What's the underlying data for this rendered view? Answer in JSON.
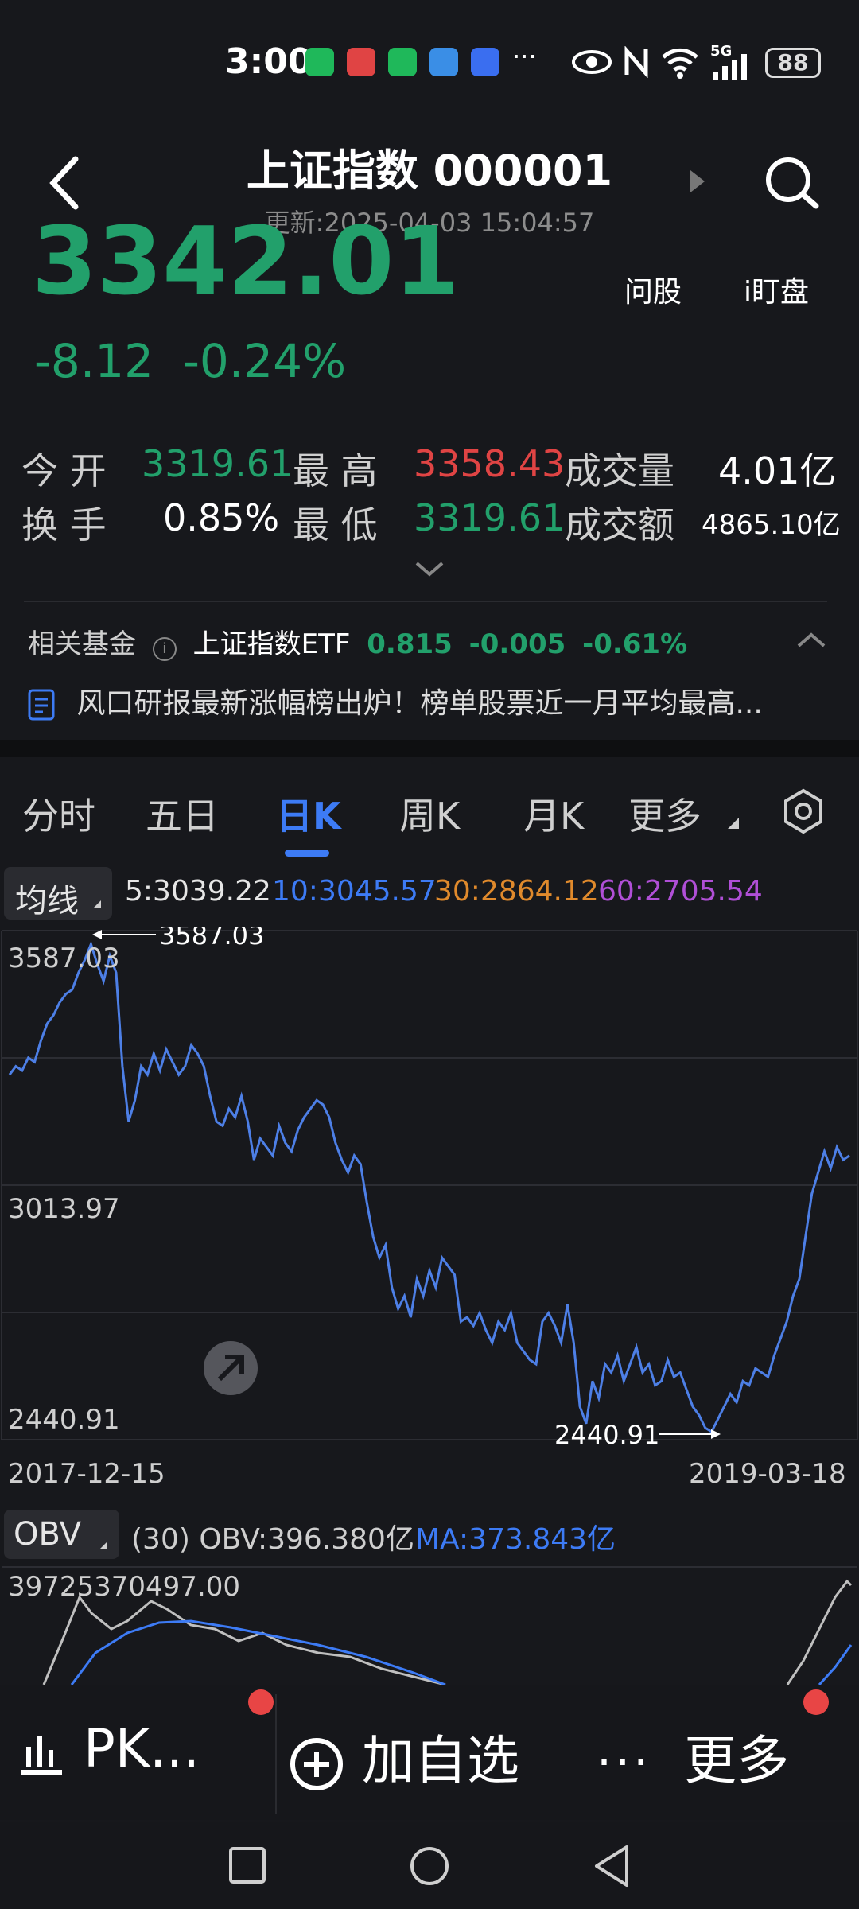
{
  "status": {
    "time": "3:00",
    "battery": "88",
    "more": "···",
    "signal": "5G"
  },
  "header": {
    "title": "上证指数 000001",
    "updated": "更新:2025-04-03 15:04:57"
  },
  "price": {
    "value": "3342.01",
    "change": "-8.12",
    "change_pct": "-0.24%",
    "ask": "问股",
    "ipan": "i盯盘"
  },
  "stats": {
    "open_label": "今  开",
    "open": "3319.61",
    "high_label": "最  高",
    "high": "3358.43",
    "volume_label": "成交量",
    "volume": "4.01亿",
    "turnover_label": "换  手",
    "turnover": "0.85%",
    "low_label": "最  低",
    "low": "3319.61",
    "amount_label": "成交额",
    "amount": "4865.10亿"
  },
  "fund": {
    "label": "相关基金",
    "name": "上证指数ETF",
    "price": "0.815",
    "change": "-0.005",
    "pct": "-0.61%"
  },
  "news": "风口研报最新涨幅榜出炉！榜单股票近一月平均最高...",
  "tabs": [
    "分时",
    "五日",
    "日K",
    "周K",
    "月K",
    "更多"
  ],
  "ma": {
    "label": "均线",
    "ma5": "5:3039.22",
    "ma10": "10:3045.57",
    "ma30": "30:2864.12",
    "ma60": "60:2705.54"
  },
  "colors": {
    "up": "#e04444",
    "down": "#22a06b",
    "accent": "#3d7bf5",
    "ma30": "#e08a2c",
    "ma60": "#b04fd6"
  },
  "chart_data": {
    "type": "line",
    "x_start": "2017-12-15",
    "x_end": "2019-03-18",
    "y_labels": [
      "3587.03",
      "3013.97",
      "2440.91"
    ],
    "high_marker": "3587.03",
    "low_marker": "2440.91",
    "ylim": [
      2440.91,
      3587.03
    ],
    "values": [
      3280,
      3300,
      3290,
      3320,
      3310,
      3360,
      3400,
      3420,
      3450,
      3470,
      3480,
      3520,
      3550,
      3587,
      3540,
      3500,
      3560,
      3520,
      3300,
      3170,
      3220,
      3300,
      3280,
      3330,
      3290,
      3340,
      3310,
      3280,
      3300,
      3350,
      3330,
      3300,
      3230,
      3170,
      3160,
      3200,
      3180,
      3230,
      3170,
      3080,
      3130,
      3110,
      3090,
      3160,
      3120,
      3100,
      3150,
      3180,
      3200,
      3220,
      3210,
      3180,
      3120,
      3080,
      3050,
      3090,
      3070,
      2980,
      2900,
      2850,
      2880,
      2780,
      2730,
      2760,
      2710,
      2800,
      2760,
      2820,
      2780,
      2850,
      2830,
      2810,
      2700,
      2710,
      2690,
      2720,
      2680,
      2650,
      2700,
      2680,
      2720,
      2650,
      2630,
      2610,
      2600,
      2700,
      2720,
      2690,
      2650,
      2740,
      2650,
      2500,
      2460,
      2560,
      2520,
      2600,
      2580,
      2620,
      2560,
      2600,
      2640,
      2580,
      2600,
      2550,
      2560,
      2610,
      2570,
      2580,
      2540,
      2500,
      2480,
      2450,
      2441,
      2470,
      2500,
      2530,
      2510,
      2560,
      2550,
      2590,
      2580,
      2570,
      2620,
      2660,
      2700,
      2760,
      2800,
      2900,
      3000,
      3050,
      3100,
      3060,
      3110,
      3080,
      3090
    ]
  },
  "obv": {
    "label": "OBV",
    "info": "(30) OBV:396.380亿",
    "ma": "MA:373.843亿",
    "top": "39725370497.00"
  },
  "bottom": {
    "pk": "PK...",
    "add": "加自选",
    "more": "更多"
  }
}
